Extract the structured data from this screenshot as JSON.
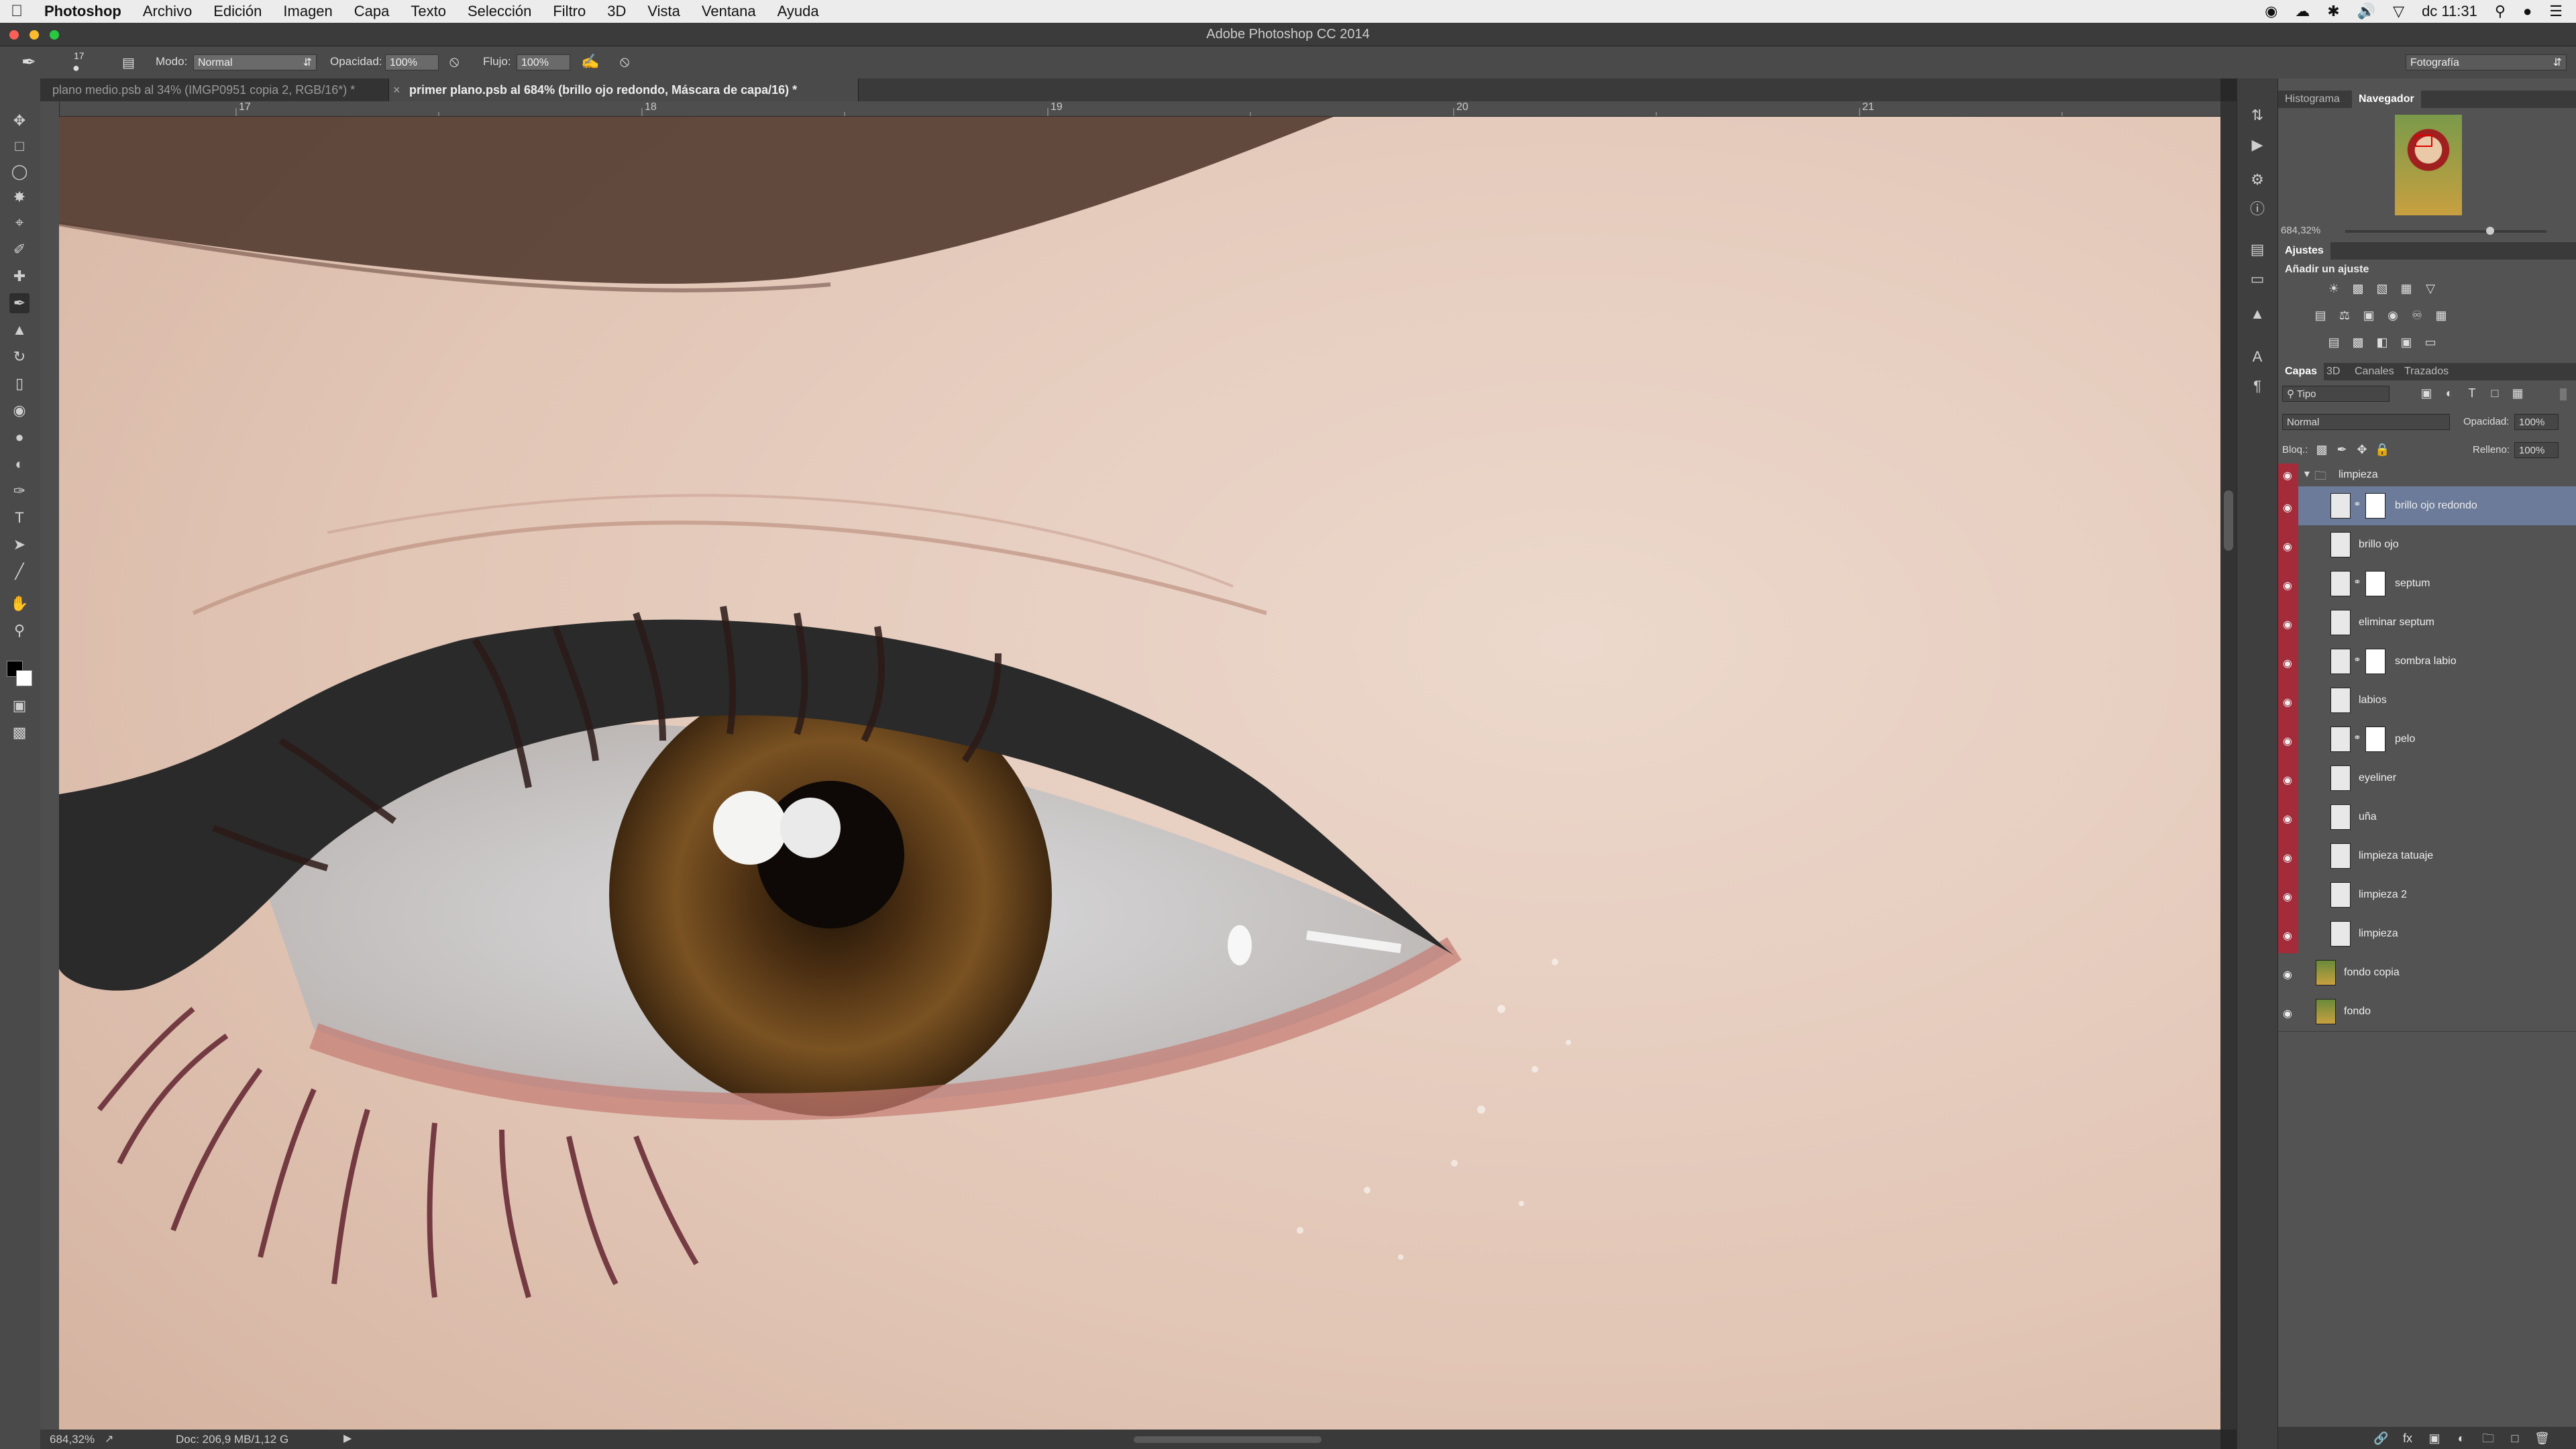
{
  "mac_menubar": {
    "app_name": "Photoshop",
    "items": [
      "Archivo",
      "Edición",
      "Imagen",
      "Capa",
      "Texto",
      "Selección",
      "Filtro",
      "3D",
      "Vista",
      "Ventana",
      "Ayuda"
    ],
    "clock": "dc 11:31"
  },
  "window": {
    "title": "Adobe Photoshop CC 2014"
  },
  "options_bar": {
    "brush_size": "17",
    "mode_label": "Modo:",
    "mode_value": "Normal",
    "opacity_label": "Opacidad:",
    "opacity_value": "100%",
    "flow_label": "Flujo:",
    "flow_value": "100%",
    "workspace": "Fotografía"
  },
  "document_tabs": [
    {
      "label": "plano medio.psb al 34% (IMGP0951 copia 2, RGB/16*) *",
      "active": false
    },
    {
      "label": "primer plano.psb al 684% (brillo ojo redondo, Máscara de capa/16) *",
      "active": true
    }
  ],
  "ruler": {
    "ticks": [
      "17",
      "18",
      "19",
      "20",
      "21"
    ]
  },
  "status_bar": {
    "zoom": "684,32%",
    "doc_info": "Doc: 206,9 MB/1,12 G"
  },
  "navigator": {
    "tabs": [
      "Histograma",
      "Navegador"
    ],
    "active_tab": "Navegador",
    "zoom": "684,32%"
  },
  "adjustments": {
    "title": "Ajustes",
    "subtitle": "Añadir un ajuste"
  },
  "layers_panel": {
    "tabs": [
      "Capas",
      "3D",
      "Canales",
      "Trazados"
    ],
    "active_tab": "Capas",
    "filter_label": "Tipo",
    "blend_mode": "Normal",
    "opacity_label": "Opacidad:",
    "opacity_value": "100%",
    "lock_label": "Bloq.:",
    "fill_label": "Relleno:",
    "fill_value": "100%",
    "group_name": "limpieza",
    "layers": [
      {
        "name": "brillo ojo redondo",
        "mask": true,
        "selected": true,
        "in_group": true,
        "photo": false
      },
      {
        "name": "brillo ojo",
        "mask": false,
        "selected": false,
        "in_group": true,
        "photo": false
      },
      {
        "name": "septum",
        "mask": true,
        "selected": false,
        "in_group": true,
        "photo": false
      },
      {
        "name": "eliminar septum",
        "mask": false,
        "selected": false,
        "in_group": true,
        "photo": false
      },
      {
        "name": "sombra labio",
        "mask": true,
        "selected": false,
        "in_group": true,
        "photo": false
      },
      {
        "name": "labios",
        "mask": false,
        "selected": false,
        "in_group": true,
        "photo": false
      },
      {
        "name": "pelo",
        "mask": true,
        "selected": false,
        "in_group": true,
        "photo": false
      },
      {
        "name": "eyeliner",
        "mask": false,
        "selected": false,
        "in_group": true,
        "photo": false
      },
      {
        "name": "uña",
        "mask": false,
        "selected": false,
        "in_group": true,
        "photo": false
      },
      {
        "name": "limpieza tatuaje",
        "mask": false,
        "selected": false,
        "in_group": true,
        "photo": false
      },
      {
        "name": "limpieza 2",
        "mask": false,
        "selected": false,
        "in_group": true,
        "photo": false
      },
      {
        "name": "limpieza",
        "mask": false,
        "selected": false,
        "in_group": true,
        "photo": false
      },
      {
        "name": "fondo copia",
        "mask": false,
        "selected": false,
        "in_group": false,
        "photo": true
      },
      {
        "name": "fondo",
        "mask": false,
        "selected": false,
        "in_group": false,
        "photo": true
      }
    ]
  },
  "colors": {
    "accent": "#a42b3a",
    "selection": "#6b7b99",
    "brand": "#c00d1e"
  }
}
